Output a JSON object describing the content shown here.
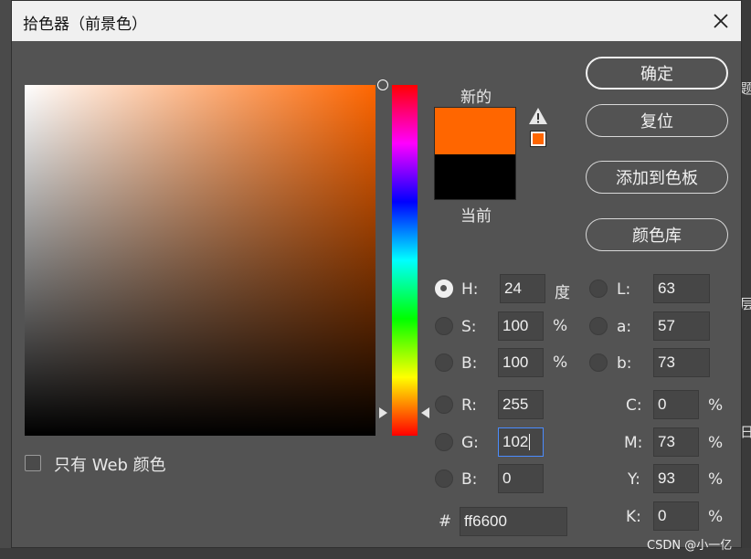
{
  "dialog": {
    "title": "拾色器（前景色）"
  },
  "preview": {
    "new_label": "新的",
    "current_label": "当前",
    "new_color": "#ff6600",
    "current_color": "#000000"
  },
  "buttons": {
    "ok": "确定",
    "reset": "复位",
    "add_to_swatches": "添加到色板",
    "color_libraries": "颜色库"
  },
  "only_web_colors": "只有 Web 颜色",
  "hsb": {
    "h": {
      "label": "H:",
      "value": "24",
      "unit": "度"
    },
    "s": {
      "label": "S:",
      "value": "100",
      "unit": "%"
    },
    "b": {
      "label": "B:",
      "value": "100",
      "unit": "%"
    }
  },
  "lab": {
    "l": {
      "label": "L:",
      "value": "63"
    },
    "a": {
      "label": "a:",
      "value": "57"
    },
    "b": {
      "label": "b:",
      "value": "73"
    }
  },
  "rgb": {
    "r": {
      "label": "R:",
      "value": "255"
    },
    "g": {
      "label": "G:",
      "value": "102"
    },
    "b": {
      "label": "B:",
      "value": "0"
    }
  },
  "cmyk": {
    "c": {
      "label": "C:",
      "value": "0",
      "unit": "%"
    },
    "m": {
      "label": "M:",
      "value": "73",
      "unit": "%"
    },
    "y": {
      "label": "Y:",
      "value": "93",
      "unit": "%"
    },
    "k": {
      "label": "K:",
      "value": "0",
      "unit": "%"
    }
  },
  "hex": {
    "label": "#",
    "value": "ff6600"
  },
  "background": {
    "frag1": "题",
    "frag2": "层",
    "frag3": "日"
  },
  "watermark": "CSDN @小一亿"
}
